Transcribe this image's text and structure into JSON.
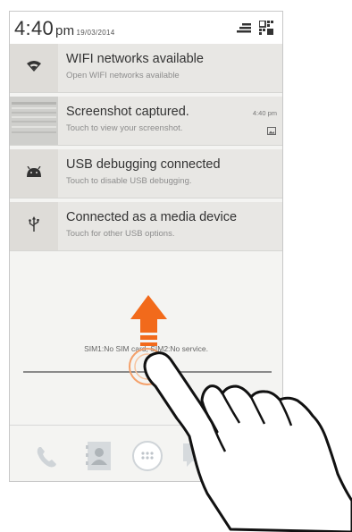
{
  "status_bar": {
    "time": "4:40",
    "ampm": "pm",
    "date": "19/03/2014",
    "icons": [
      "signal-icon",
      "grid-icon"
    ]
  },
  "notifications": [
    {
      "icon": "wifi-icon",
      "title": "WIFI networks available",
      "subtitle": "Open WIFI networks available"
    },
    {
      "icon": "screenshot-thumbnail",
      "title": "Screenshot captured.",
      "subtitle": "Touch to view your screenshot.",
      "time": "4:40 pm",
      "extra_icon": "image-icon"
    },
    {
      "icon": "android-icon",
      "title": "USB debugging connected",
      "subtitle": "Touch to disable USB debugging."
    },
    {
      "icon": "usb-icon",
      "title": "Connected as a media device",
      "subtitle": "Touch for other USB options."
    }
  ],
  "sim_status": "SIM1:No SIM card, SIM2:No service.",
  "dock": {
    "items": [
      "phone-icon",
      "contacts-icon",
      "app-drawer-icon",
      "messages-icon"
    ]
  },
  "colors": {
    "arrow": "#f26a1b",
    "panel_bg": "#f4f4f2",
    "notif_bg": "#e8e7e4"
  }
}
